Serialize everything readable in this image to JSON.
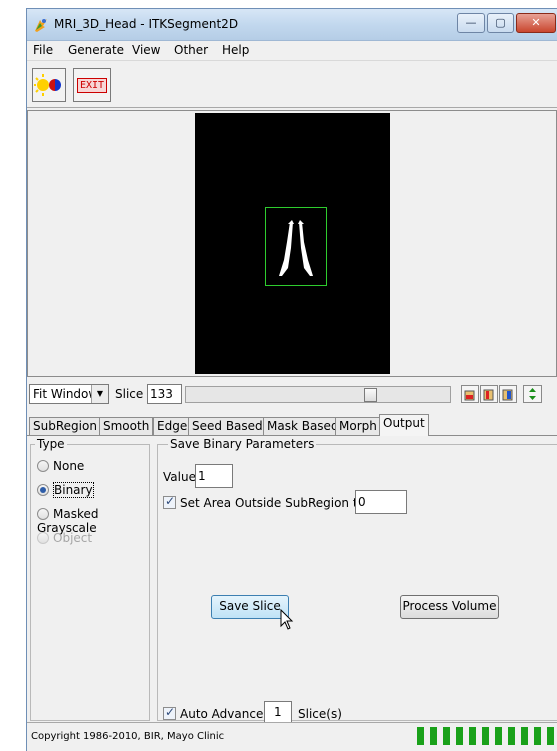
{
  "window": {
    "title": "MRI_3D_Head - ITKSegment2D",
    "minimize_label": "—",
    "maximize_label": "▢",
    "close_label": "✕"
  },
  "menu": [
    "File",
    "Generate",
    "View",
    "Other",
    "Help"
  ],
  "toolbar": {
    "color_button_icon": "sun-colormap-icon",
    "exit_label": "EXIT"
  },
  "image_view": {
    "background": "#000000",
    "subregion_color": "#2ecc2e"
  },
  "slice_controls": {
    "fit_option": "Fit Window",
    "slice_label": "Slice",
    "slice_value": "133",
    "slider_fraction": 0.71
  },
  "tabs": [
    "SubRegion",
    "Smooth",
    "Edge",
    "Seed Based",
    "Mask Based",
    "Morph",
    "Output"
  ],
  "active_tab": "Output",
  "type_group": {
    "title": "Type",
    "options": [
      {
        "label": "None",
        "checked": false,
        "disabled": false
      },
      {
        "label": "Binary",
        "checked": true,
        "disabled": false
      },
      {
        "label": "Masked Grayscale",
        "checked": false,
        "disabled": false
      },
      {
        "label": "Object",
        "checked": false,
        "disabled": true
      }
    ]
  },
  "save_group": {
    "title": "Save Binary Parameters",
    "value_label": "Value",
    "value": "1",
    "outside_label": "Set Area Outside SubRegion to",
    "outside_checked": true,
    "outside_value": "0",
    "save_slice_label": "Save Slice",
    "process_volume_label": "Process Volume",
    "auto_advance_label": "Auto Advance",
    "auto_advance_checked": true,
    "auto_advance_value": "1",
    "slices_label": "Slice(s)"
  },
  "status": {
    "copyright": "Copyright 1986-2010, BIR, Mayo Clinic",
    "progress_color": "#1aa11a"
  }
}
